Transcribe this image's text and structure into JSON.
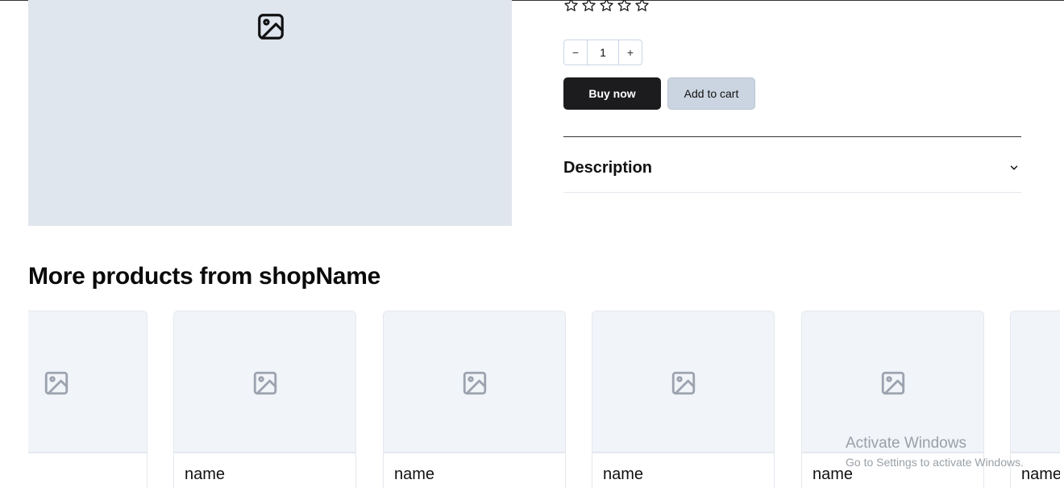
{
  "product": {
    "image_icon": "image-placeholder-icon",
    "rating": {
      "filled": 0,
      "total": 5,
      "icon": "star-outline-icon"
    },
    "quantity": {
      "value": "1",
      "decrement_label": "−",
      "increment_label": "+"
    },
    "buy_now_label": "Buy now",
    "add_to_cart_label": "Add to cart",
    "description_label": "Description",
    "description_icon": "chevron-down-icon"
  },
  "more_products": {
    "title": "More products from shopName",
    "cards": [
      {
        "name": ""
      },
      {
        "name": "name"
      },
      {
        "name": "name"
      },
      {
        "name": "name"
      },
      {
        "name": "name"
      },
      {
        "name": "name"
      }
    ]
  },
  "watermark": {
    "title": "Activate Windows",
    "subtitle": "Go to Settings to activate Windows."
  },
  "colors": {
    "primary_button": "#1c1c1e",
    "secondary_button": "#cbd5e1",
    "image_placeholder_bg": "#e0e6ee",
    "card_thumb_bg": "#f1f4f8"
  }
}
